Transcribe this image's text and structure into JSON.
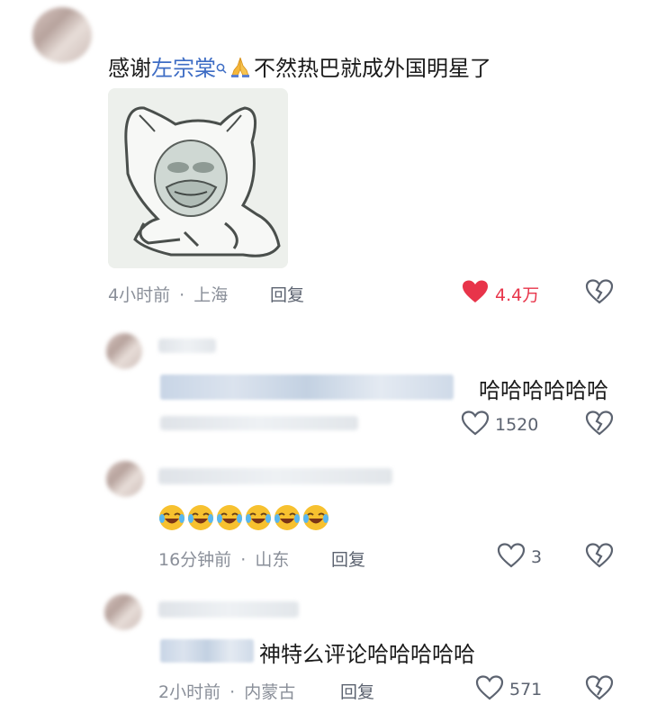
{
  "comments": [
    {
      "text_before_link": "感谢",
      "link_text": "左宗棠",
      "text_after": "不然热巴就成外国明星了",
      "time": "4小时前",
      "location": "上海",
      "reply_label": "回复",
      "likes": "4.4万",
      "liked": true
    },
    {
      "text": "哈哈哈哈哈哈",
      "likes": "1520",
      "liked": false
    },
    {
      "emoji_count": 6,
      "time": "16分钟前",
      "location": "山东",
      "reply_label": "回复",
      "likes": "3",
      "liked": false
    },
    {
      "text": "神特么评论哈哈哈哈哈",
      "time": "2小时前",
      "location": "内蒙古",
      "reply_label": "回复",
      "likes": "571",
      "liked": false
    }
  ],
  "separator": "·",
  "icons": {
    "search": "search-icon",
    "pray": "folded-hands-icon",
    "heart": "heart-icon",
    "dislike": "broken-heart-icon",
    "laugh": "laughing-crying-emoji-icon"
  },
  "colors": {
    "link": "#3d6cc4",
    "liked_heart": "#e8344a",
    "meta": "#8a8f99"
  }
}
